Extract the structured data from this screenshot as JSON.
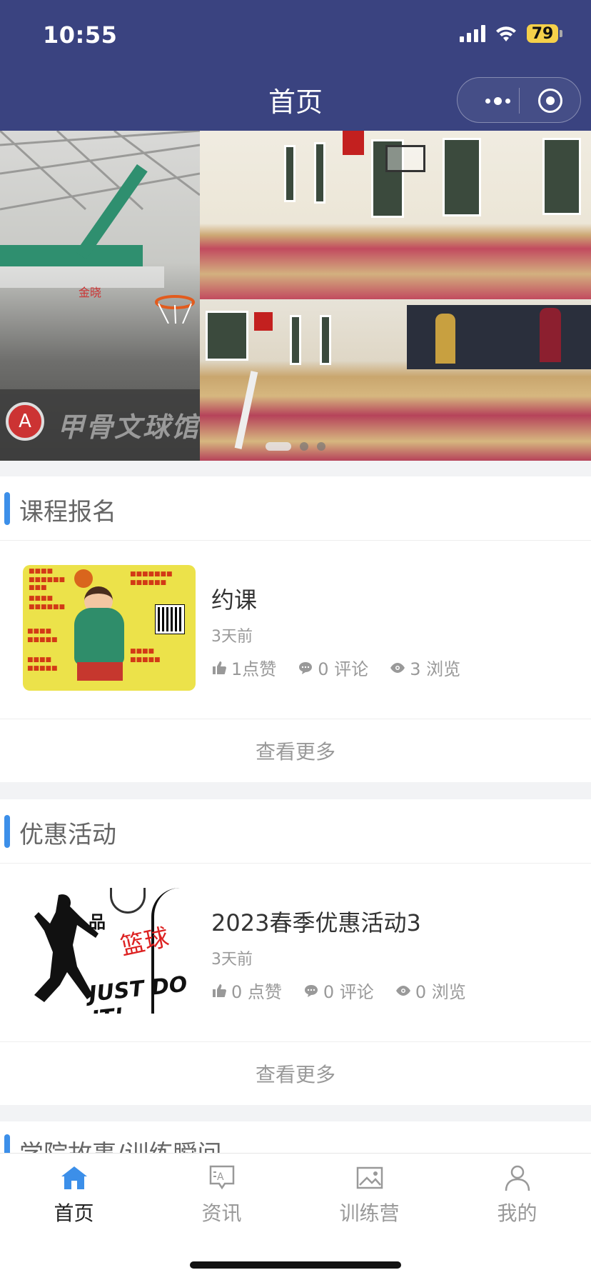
{
  "status_bar": {
    "time": "10:55",
    "battery": "79"
  },
  "nav": {
    "title": "首页"
  },
  "banner": {
    "watermark": "甲骨文球馆",
    "logo_letter": "A",
    "dots_count": 3,
    "active_dot": 0
  },
  "sections": [
    {
      "title": "课程报名",
      "item": {
        "title": "约课",
        "time": "3天前",
        "likes": "1点赞",
        "comments": "0 评论",
        "views": "3 浏览"
      },
      "more": "查看更多"
    },
    {
      "title": "优惠活动",
      "item": {
        "title": "2023春季优惠活动3",
        "time": "3天前",
        "likes": "0 点赞",
        "comments": "0 评论",
        "views": "0 浏览"
      },
      "more": "查看更多",
      "thumb_text": {
        "top": "品",
        "red": "篮球",
        "slogan": "JUST DO IT!"
      }
    }
  ],
  "partial_section": {
    "title": "学院故事/训练瞬间"
  },
  "tabs": [
    {
      "label": "首页",
      "icon": "home-icon",
      "active": true
    },
    {
      "label": "资讯",
      "icon": "news-icon",
      "active": false
    },
    {
      "label": "训练营",
      "icon": "image-icon",
      "active": false
    },
    {
      "label": "我的",
      "icon": "user-icon",
      "active": false
    }
  ],
  "colors": {
    "header": "#3a4380",
    "accent": "#3c8fe9",
    "battery": "#f5d04a"
  }
}
